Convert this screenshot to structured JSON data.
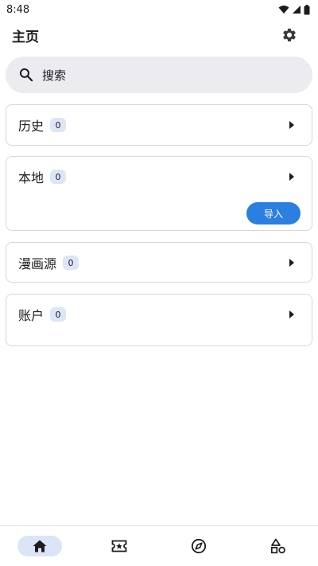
{
  "status_bar": {
    "time": "8:48"
  },
  "app_bar": {
    "title": "主页"
  },
  "search": {
    "placeholder": "搜索"
  },
  "cards": [
    {
      "title": "历史",
      "count": "0"
    },
    {
      "title": "本地",
      "count": "0",
      "action": "导入"
    },
    {
      "title": "漫画源",
      "count": "0"
    },
    {
      "title": "账户",
      "count": "0"
    }
  ],
  "bottom_nav": {
    "items": [
      {
        "icon": "home-icon",
        "active": true
      },
      {
        "icon": "ticket-star-icon",
        "active": false
      },
      {
        "icon": "compass-icon",
        "active": false
      },
      {
        "icon": "shapes-icon",
        "active": false
      }
    ]
  },
  "colors": {
    "accent": "#2b7fe0",
    "badge_bg": "#dde6f7",
    "search_bg": "#ebebf0"
  }
}
